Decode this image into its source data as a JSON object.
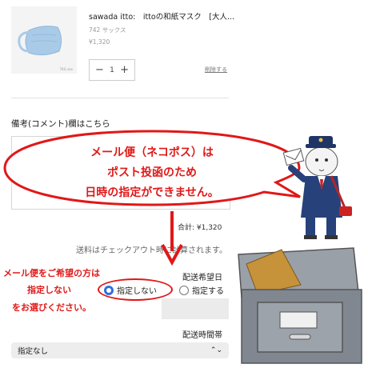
{
  "product": {
    "title": "sawada itto:　ittoの和紙マスク　[大人...",
    "variant": "742 サックス",
    "price": "¥1,320",
    "thumbnail_caption": "74G sax",
    "quantity": "1",
    "decrement_label": "−",
    "increment_label": "+",
    "remove_label": "削除する"
  },
  "note": {
    "label": "備考(コメント)欄はこちら"
  },
  "totals": {
    "subtotal": "合計: ¥1,320",
    "shipping_note": "送料はチェックアウト時に計算されます。"
  },
  "delivery_date": {
    "label": "配送希望日",
    "options": [
      {
        "label": "指定しない",
        "selected": true
      },
      {
        "label": "指定する",
        "selected": false
      }
    ]
  },
  "delivery_time": {
    "label": "配送時間帯",
    "selected": "指定なし"
  },
  "callout": {
    "lines": [
      "メール便（ネコポス）は",
      "ポスト投函のため",
      "日時の指定ができません。"
    ],
    "color": "#e01818"
  },
  "instruction": {
    "lines": [
      "メール便をご希望の方は",
      "指定しない",
      "をお選びください。"
    ],
    "color": "#e01818"
  },
  "colors": {
    "radio_accent": "#2f6fe0",
    "mask": "#a9cbe8"
  }
}
